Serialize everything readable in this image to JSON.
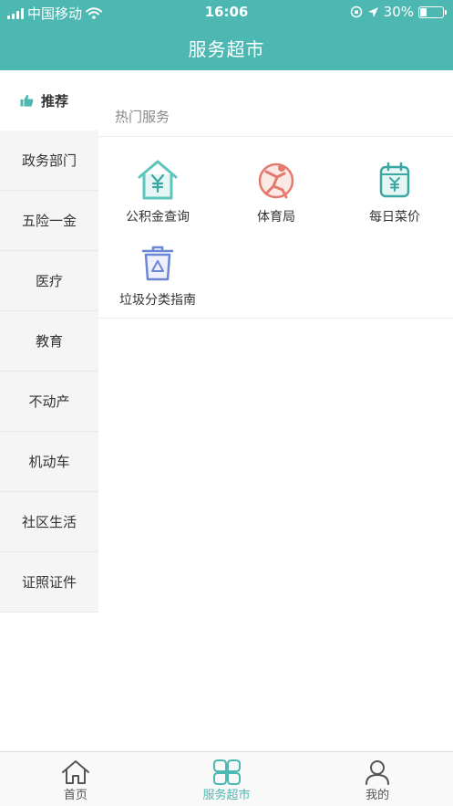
{
  "status_bar": {
    "carrier": "中国移动",
    "time": "16:06",
    "battery": "30%",
    "battery_level": 0.3
  },
  "header": {
    "title": "服务超市"
  },
  "sidebar": {
    "items": [
      {
        "label": "推荐",
        "active": true,
        "icon": "thumbs-up-icon"
      },
      {
        "label": "政务部门"
      },
      {
        "label": "五险一金"
      },
      {
        "label": "医疗"
      },
      {
        "label": "教育"
      },
      {
        "label": "不动产"
      },
      {
        "label": "机动车"
      },
      {
        "label": "社区生活"
      },
      {
        "label": "证照证件"
      }
    ]
  },
  "main": {
    "section_title": "热门服务",
    "services": [
      {
        "label": "公积金查询",
        "icon": "house-yuan-icon"
      },
      {
        "label": "体育局",
        "icon": "sports-figure-icon"
      },
      {
        "label": "每日菜价",
        "icon": "calendar-yuan-icon"
      },
      {
        "label": "垃圾分类指南",
        "icon": "recycle-bin-icon"
      }
    ]
  },
  "tabbar": {
    "tabs": [
      {
        "label": "首页",
        "icon": "home-icon"
      },
      {
        "label": "服务超市",
        "icon": "clover-grid-icon",
        "active": true
      },
      {
        "label": "我的",
        "icon": "user-icon"
      }
    ]
  },
  "colors": {
    "accent": "#4db8b2",
    "sidebar_bg": "#f5f5f5",
    "sports_red": "#e47a6e",
    "bin_blue": "#6b86d6"
  }
}
